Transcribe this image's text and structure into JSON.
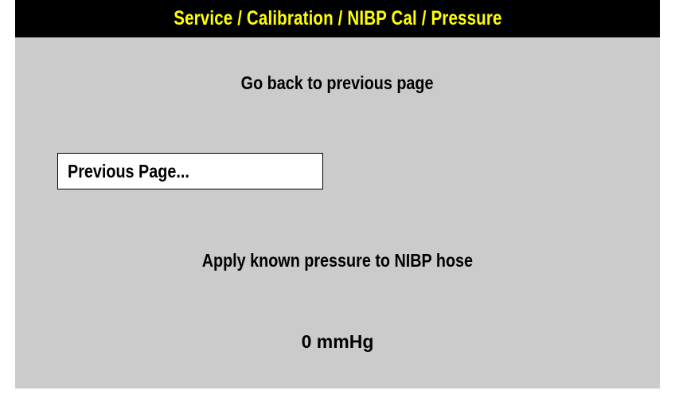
{
  "header": {
    "title": "Service / Calibration / NIBP Cal / Pressure"
  },
  "navigation": {
    "hint": "Go back to previous page",
    "previous_button_label": "Previous Page..."
  },
  "calibration": {
    "instruction": "Apply known pressure to NIBP hose",
    "pressure_value": "0",
    "pressure_unit": "mmHg",
    "pressure_reading": "0 mmHg"
  },
  "colors": {
    "title_bar_background": "#000000",
    "title_text": "#ffff00",
    "screen_background": "#cbcbcb",
    "button_background": "#ffffff"
  }
}
